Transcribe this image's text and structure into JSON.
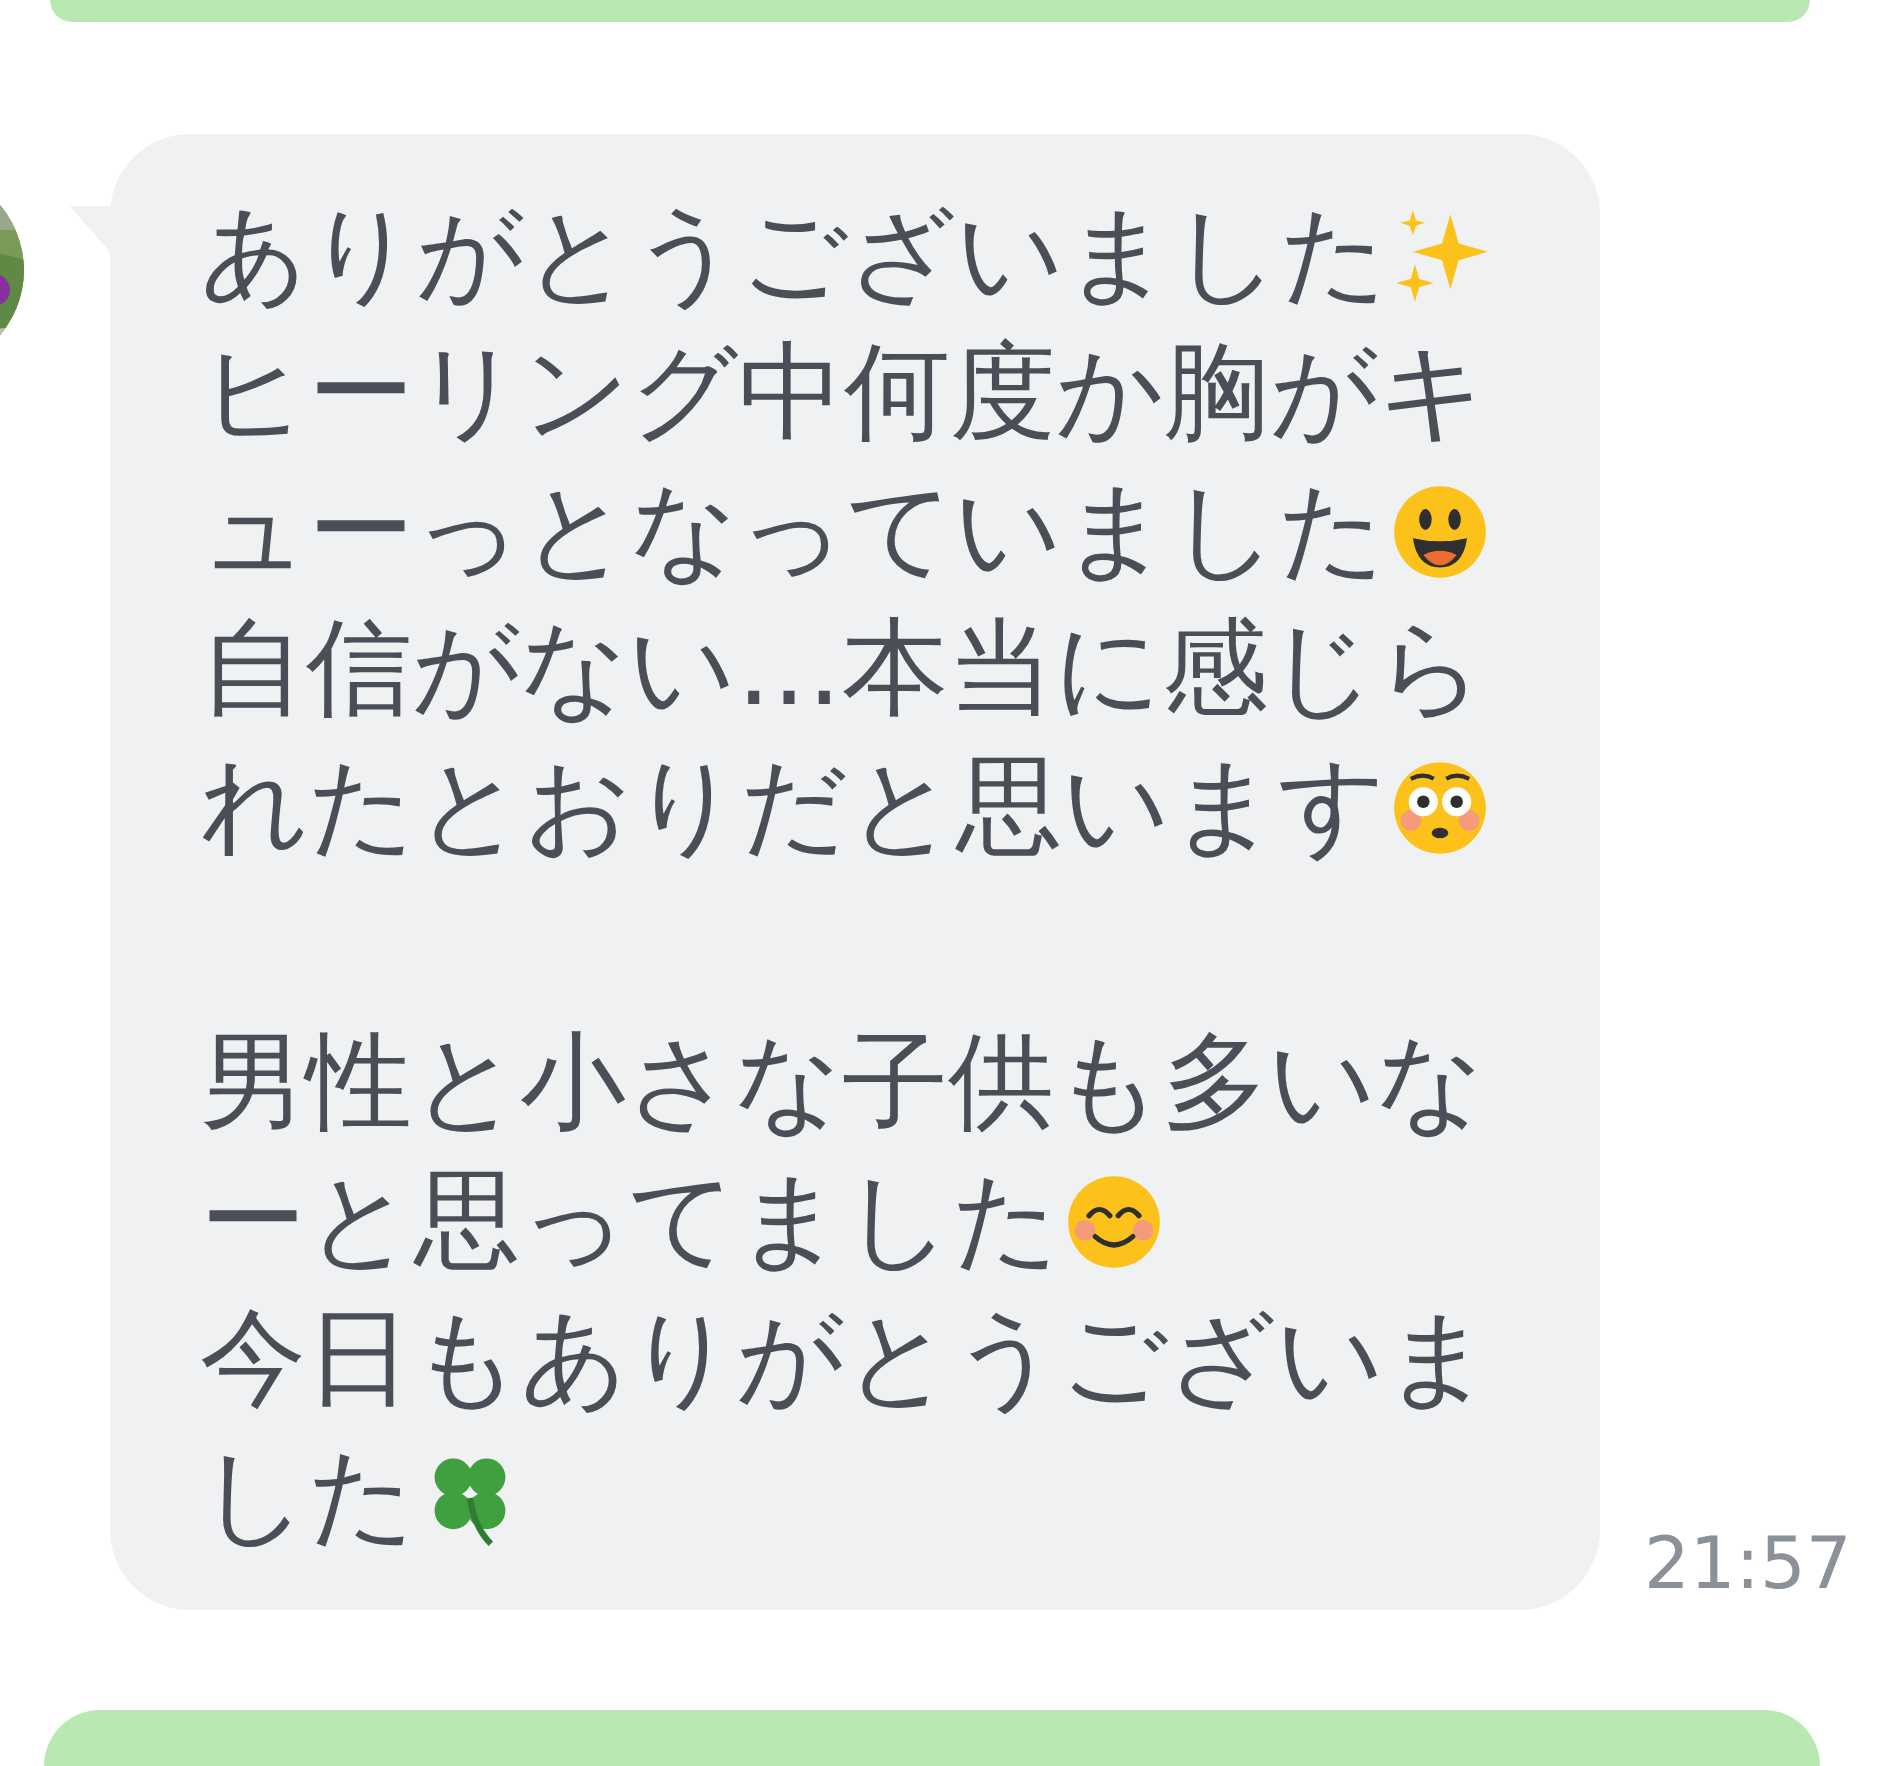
{
  "message": {
    "paragraphs": [
      {
        "lines": [
          {
            "text": "ありがとうございました",
            "kind": "sparkles"
          },
          {
            "text": "ヒーリング中何度か胸がキ",
            "kind": "plain"
          },
          {
            "text": "ューっとなっていました",
            "kind": "smiley"
          },
          {
            "text": "自信がない…本当に感じら",
            "kind": "plain"
          },
          {
            "text": "れたとおりだと思います",
            "kind": "flushed"
          }
        ]
      },
      {
        "lines": [
          {
            "text": "男性と小さな子供も多いな",
            "kind": "plain"
          },
          {
            "text": "ーと思ってました",
            "kind": "blush"
          },
          {
            "text": "今日もありがとうございま",
            "kind": "plain"
          },
          {
            "text": "した",
            "kind": "clover"
          }
        ]
      }
    ],
    "time": "21:57"
  }
}
